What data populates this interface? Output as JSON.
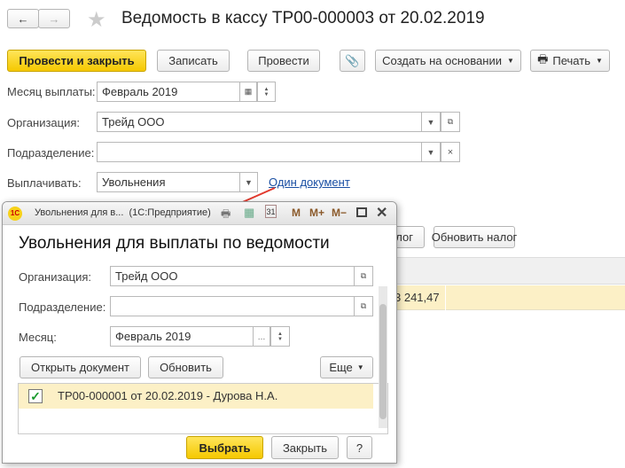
{
  "main": {
    "title": "Ведомость в кассу ТР00-000003 от 20.02.2019",
    "toolbar": {
      "post_close": "Провести и закрыть",
      "save": "Записать",
      "post": "Провести",
      "create_based": "Создать на основании",
      "print": "Печать"
    },
    "fields": {
      "month_label": "Месяц выплаты:",
      "month_value": "Февраль 2019",
      "org_label": "Организация:",
      "org_value": "Трейд ООО",
      "dept_label": "Подразделение:",
      "dept_value": "",
      "pay_label": "Выплачивать:",
      "pay_value": "Увольнения",
      "one_doc_link": "Один документ"
    },
    "bg_buttons": {
      "tax_partial": "лог",
      "update_tax": "Обновить налог"
    },
    "table": {
      "amount": "3 241,47"
    }
  },
  "dialog": {
    "window_title": "Увольнения для в...  (1С:Предприятие)",
    "logo": "1С",
    "tools": [
      "M",
      "M+",
      "M−"
    ],
    "heading": "Увольнения для выплаты по ведомости",
    "org_label": "Организация:",
    "org_value": "Трейд ООО",
    "dept_label": "Подразделение:",
    "dept_value": "",
    "month_label": "Месяц:",
    "month_value": "Февраль 2019",
    "open_doc": "Открыть документ",
    "refresh": "Обновить",
    "more": "Еще",
    "items": [
      {
        "text": "ТР00-000001 от 20.02.2019 - Дурова Н.А.",
        "checked": true
      }
    ],
    "select": "Выбрать",
    "close": "Закрыть",
    "help": "?"
  }
}
